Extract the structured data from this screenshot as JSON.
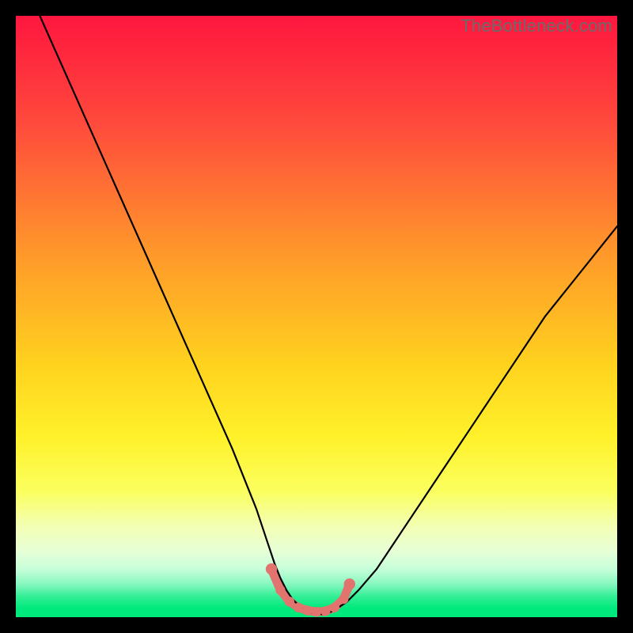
{
  "watermark": "TheBottleneck.com",
  "colors": {
    "marker": "#e1746e",
    "curve": "#000000",
    "top": "#ff1a41",
    "mid": "#ffd400",
    "bottom_band": "#f6ffb5",
    "green": "#00e97c"
  },
  "chart_data": {
    "type": "line",
    "title": "",
    "xlabel": "",
    "ylabel": "",
    "xlim": [
      0,
      100
    ],
    "ylim": [
      0,
      100
    ],
    "series": [
      {
        "name": "bottleneck-curve",
        "x": [
          0,
          4,
          8,
          12,
          16,
          20,
          24,
          28,
          32,
          36,
          38,
          40,
          42,
          43,
          44,
          45,
          46,
          47,
          48,
          49,
          50,
          51,
          52,
          53,
          55,
          57,
          60,
          64,
          68,
          72,
          76,
          80,
          84,
          88,
          92,
          96,
          100
        ],
        "y": [
          108,
          100,
          91,
          82,
          73,
          64,
          55,
          46,
          37,
          28,
          23,
          18,
          12,
          9,
          6.5,
          4.5,
          3,
          2,
          1.3,
          0.8,
          0.5,
          0.5,
          0.7,
          1.2,
          2.5,
          4.5,
          8,
          14,
          20,
          26,
          32,
          38,
          44,
          50,
          55,
          60,
          65
        ]
      }
    ],
    "marker_points": {
      "name": "flat-region-dots",
      "x": [
        42.5,
        44,
        45.5,
        47,
        48.5,
        50,
        51.5,
        53,
        54.5,
        55.5
      ],
      "y": [
        8,
        4.5,
        2.6,
        1.6,
        1.1,
        0.9,
        1.0,
        1.6,
        3.0,
        5.5
      ]
    },
    "gradient_stops": [
      {
        "pct": 0,
        "color": "#ff163f"
      },
      {
        "pct": 18,
        "color": "#ff4a3c"
      },
      {
        "pct": 40,
        "color": "#ff9a2a"
      },
      {
        "pct": 58,
        "color": "#ffd21e"
      },
      {
        "pct": 70,
        "color": "#fff12a"
      },
      {
        "pct": 79,
        "color": "#fbff5e"
      },
      {
        "pct": 85,
        "color": "#f3ffb5"
      },
      {
        "pct": 89,
        "color": "#e7ffd6"
      },
      {
        "pct": 92,
        "color": "#c6ffda"
      },
      {
        "pct": 94.5,
        "color": "#87f7bf"
      },
      {
        "pct": 96.5,
        "color": "#35ef97"
      },
      {
        "pct": 98.5,
        "color": "#00e97c"
      },
      {
        "pct": 100,
        "color": "#00e97c"
      }
    ]
  }
}
